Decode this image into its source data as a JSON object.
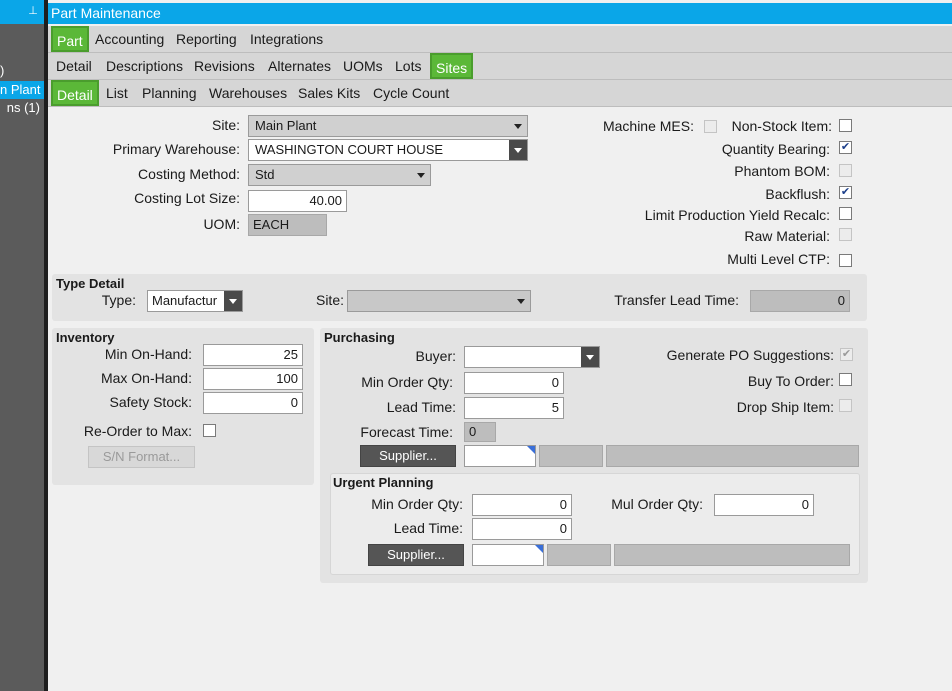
{
  "left_panel": {
    "pin_icon": "pin-icon",
    "text1": ")",
    "selected": "n Plant",
    "text2": "ns (1)"
  },
  "window": {
    "title": "Part Maintenance"
  },
  "tabs_top": [
    "Part",
    "Accounting",
    "Reporting",
    "Integrations"
  ],
  "tabs_second": [
    "Detail",
    "Descriptions",
    "Revisions",
    "Alternates",
    "UOMs",
    "Lots",
    "Sites"
  ],
  "tabs_third": [
    "Detail",
    "List",
    "Planning",
    "Warehouses",
    "Sales Kits",
    "Cycle Count"
  ],
  "site_section": {
    "site_label": "Site:",
    "site_value": "Main Plant",
    "warehouse_label": "Primary Warehouse:",
    "warehouse_value": "WASHINGTON COURT HOUSE",
    "costing_method_label": "Costing Method:",
    "costing_method_value": "Std",
    "costing_lot_label": "Costing Lot Size:",
    "costing_lot_value": "40.00",
    "uom_label": "UOM:",
    "uom_value": "EACH"
  },
  "flags": {
    "machine_mes": {
      "label": "Machine MES:",
      "checked": false
    },
    "non_stock": {
      "label": "Non-Stock Item:",
      "checked": false
    },
    "quantity_bearing": {
      "label": "Quantity Bearing:",
      "checked": true
    },
    "phantom_bom": {
      "label": "Phantom BOM:",
      "checked": false
    },
    "backflush": {
      "label": "Backflush:",
      "checked": true
    },
    "limit_yield": {
      "label": "Limit Production Yield Recalc:",
      "checked": false
    },
    "raw_material": {
      "label": "Raw Material:",
      "checked": false
    },
    "multi_level_ctp": {
      "label": "Multi Level CTP:",
      "checked": false
    }
  },
  "type_detail": {
    "heading": "Type Detail",
    "type_label": "Type:",
    "type_value": "Manufactur",
    "site_label": "Site:",
    "site_value": "",
    "transfer_label": "Transfer Lead Time:",
    "transfer_value": "0"
  },
  "inventory": {
    "heading": "Inventory",
    "min_label": "Min On-Hand:",
    "min_value": "25",
    "max_label": "Max On-Hand:",
    "max_value": "100",
    "safety_label": "Safety Stock:",
    "safety_value": "0",
    "reorder_label": "Re-Order to Max:",
    "sn_button": "S/N Format..."
  },
  "purchasing": {
    "heading": "Purchasing",
    "buyer_label": "Buyer:",
    "buyer_value": "",
    "min_order_label": "Min Order Qty:",
    "min_order_value": "0",
    "lead_label": "Lead Time:",
    "lead_value": "5",
    "forecast_label": "Forecast Time:",
    "forecast_value": "0",
    "supplier_button": "Supplier...",
    "gen_po_label": "Generate PO Suggestions:",
    "buy_to_order_label": "Buy To Order:",
    "drop_ship_label": "Drop Ship Item:"
  },
  "urgent": {
    "heading": "Urgent Planning",
    "min_order_label": "Min Order Qty:",
    "min_order_value": "0",
    "mul_order_label": "Mul Order Qty:",
    "mul_order_value": "0",
    "lead_label": "Lead Time:",
    "lead_value": "0",
    "supplier_button": "Supplier..."
  }
}
